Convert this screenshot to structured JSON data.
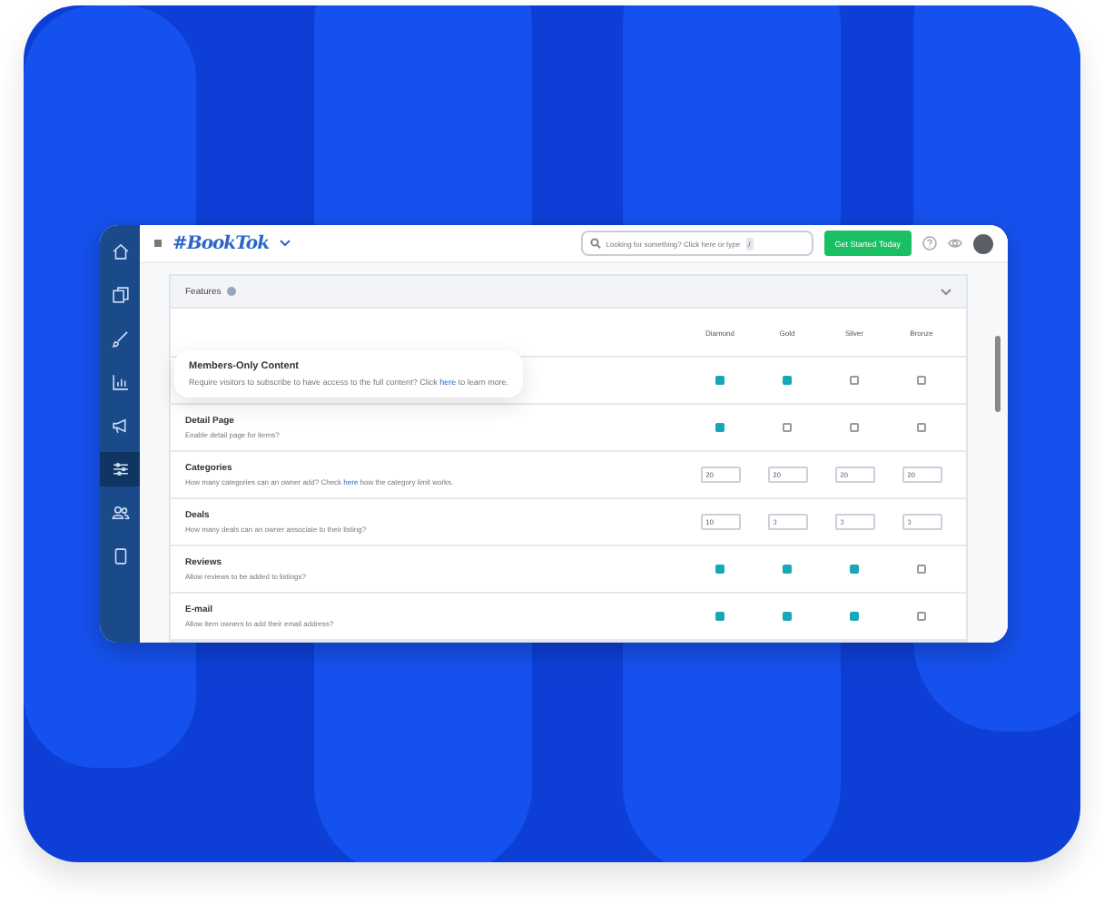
{
  "nav": {
    "items": [
      {
        "kind": "home",
        "selected": false
      },
      {
        "kind": "pages",
        "selected": false
      },
      {
        "kind": "brush",
        "selected": false
      },
      {
        "kind": "chart",
        "selected": false
      },
      {
        "kind": "megaphone",
        "selected": false
      },
      {
        "kind": "sliders",
        "selected": true
      },
      {
        "kind": "users",
        "selected": false
      },
      {
        "kind": "tablet",
        "selected": false
      }
    ]
  },
  "header": {
    "logo": "#BookTok",
    "search": {
      "placeholder": "Looking for something? Click here or type",
      "shortcut": "/"
    },
    "button": "Get Started Today"
  },
  "panel": {
    "title": "Features",
    "columns": [
      "Diamond",
      "Gold",
      "Silver",
      "Bronze"
    ],
    "rows": [
      {
        "kind": "checkbox",
        "highlighted": true,
        "title": "Members-Only Content",
        "description": "Require visitors to subscribe to have access to the full content? Click ",
        "link": "here",
        "description_end": " to learn more.",
        "values": [
          {
            "checked": true
          },
          {
            "checked": true
          },
          {
            "checked": false
          },
          {
            "checked": false
          }
        ]
      },
      {
        "kind": "checkbox",
        "highlighted": false,
        "title": "Detail Page",
        "description": "Enable detail page for items?",
        "values": [
          {
            "checked": true
          },
          {
            "checked": false
          },
          {
            "checked": false
          },
          {
            "checked": false
          }
        ]
      },
      {
        "kind": "input",
        "highlighted": false,
        "title": "Categories",
        "description": "How many categories can an owner add? Check ",
        "link": "here",
        "description_end": " how the category limit works.",
        "values": [
          {
            "value": "20"
          },
          {
            "value": "20"
          },
          {
            "value": "20"
          },
          {
            "value": "20"
          }
        ]
      },
      {
        "kind": "input",
        "highlighted": false,
        "title": "Deals",
        "description": "How many deals can an owner associate to their listing?",
        "values": [
          {
            "value": "10"
          },
          {
            "value": "0"
          },
          {
            "value": "0"
          },
          {
            "value": "0"
          }
        ]
      },
      {
        "kind": "checkbox",
        "highlighted": false,
        "title": "Reviews",
        "description": "Allow reviews to be added to listings?",
        "values": [
          {
            "checked": true
          },
          {
            "checked": true
          },
          {
            "checked": true
          },
          {
            "checked": false
          }
        ]
      },
      {
        "kind": "checkbox",
        "highlighted": false,
        "title": "E-mail",
        "description": "Allow item owners to add their email address?",
        "values": [
          {
            "checked": true
          },
          {
            "checked": true
          },
          {
            "checked": true
          },
          {
            "checked": false
          }
        ]
      }
    ]
  }
}
